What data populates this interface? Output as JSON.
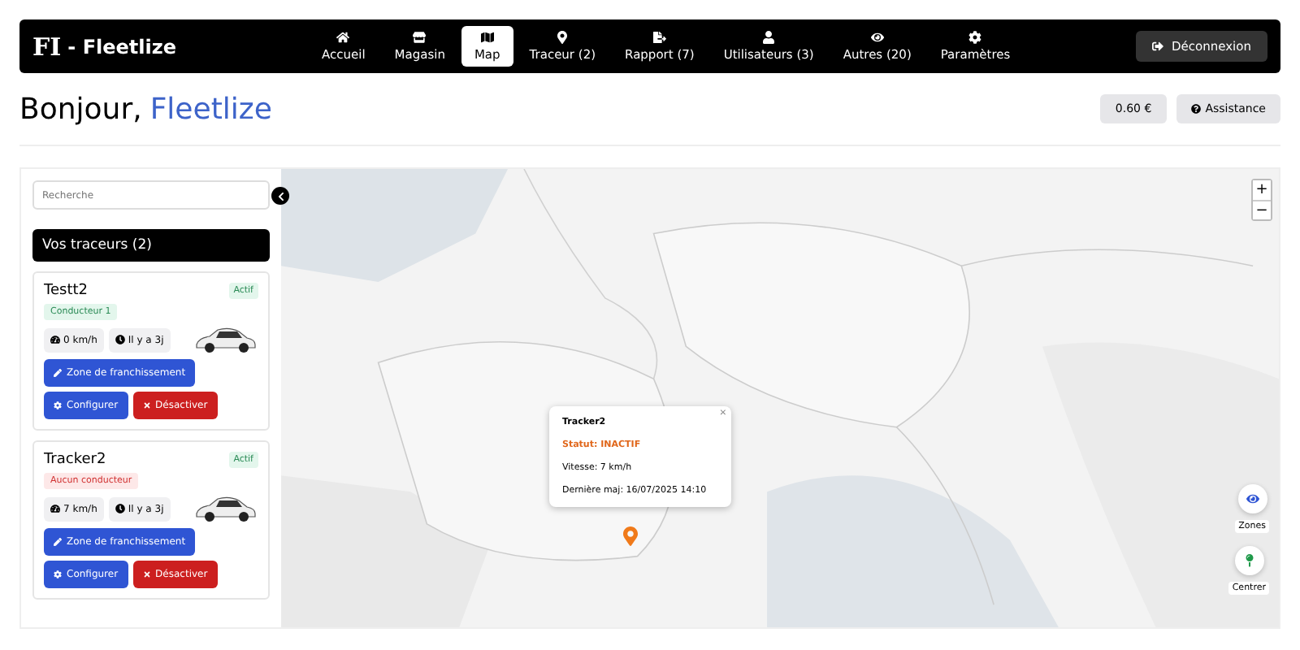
{
  "brand": {
    "logo": "FI",
    "name": "- Fleetlize"
  },
  "nav": [
    {
      "label": "Accueil",
      "selected": false
    },
    {
      "label": "Magasin",
      "selected": false
    },
    {
      "label": "Map",
      "selected": true
    },
    {
      "label": "Traceur (2)",
      "selected": false
    },
    {
      "label": "Rapport (7)",
      "selected": false
    },
    {
      "label": "Utilisateurs (3)",
      "selected": false
    },
    {
      "label": "Autres (20)",
      "selected": false
    },
    {
      "label": "Paramètres",
      "selected": false
    }
  ],
  "logout": "Déconnexion",
  "heading": {
    "greeting": "Bonjour,",
    "name": "Fleetlize"
  },
  "balance": "0.60 €",
  "assistance": "Assistance",
  "sidebar": {
    "search": {
      "placeholder": "Recherche"
    },
    "title": "Vos traceurs (2)",
    "trackers": [
      {
        "name": "Testt2",
        "status": "Actif",
        "driver": "Conducteur 1",
        "has_driver": true,
        "speed": "0 km/h",
        "time": "Il y a 3j",
        "zone": "Zone de franchissement",
        "configure": "Configurer",
        "deactivate": "Désactiver"
      },
      {
        "name": "Tracker2",
        "status": "Actif",
        "driver": "Aucun conducteur",
        "has_driver": false,
        "speed": "7 km/h",
        "time": "Il y a 3j",
        "zone": "Zone de franchissement",
        "configure": "Configurer",
        "deactivate": "Désactiver"
      }
    ]
  },
  "map": {
    "zoom_in": "+",
    "zoom_out": "−",
    "close": "×",
    "popup": {
      "title": "Tracker2",
      "status": "Statut: INACTIF",
      "speed": "Vitesse: 7 km/h",
      "updated": "Dernière maj: 16/07/2025 14:10"
    },
    "zones": "Zones",
    "center": "Centrer"
  }
}
